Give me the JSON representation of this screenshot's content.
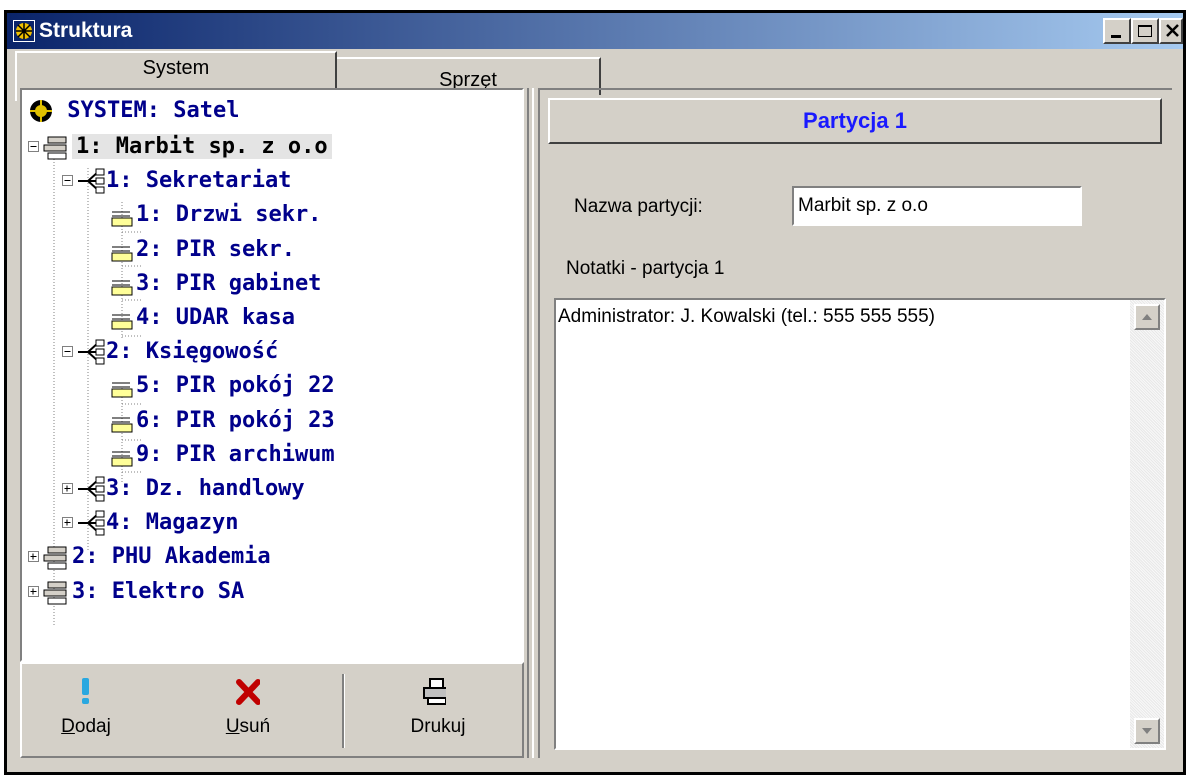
{
  "window": {
    "title": "Struktura"
  },
  "tabs": [
    {
      "label": "System"
    },
    {
      "label": "Sprzęt"
    }
  ],
  "tree": {
    "root": "SYSTEM: Satel",
    "items": [
      {
        "label": "1: Marbit sp. z o.o",
        "type": "partition",
        "expanded": true,
        "selected": true
      },
      {
        "label": "1: Sekretariat",
        "type": "zone",
        "expanded": true
      },
      {
        "label": "1: Drzwi sekr.",
        "type": "input"
      },
      {
        "label": "2: PIR sekr.",
        "type": "input"
      },
      {
        "label": "3: PIR gabinet",
        "type": "input"
      },
      {
        "label": "4: UDAR kasa",
        "type": "input"
      },
      {
        "label": "2: Księgowość",
        "type": "zone",
        "expanded": true
      },
      {
        "label": "5: PIR pokój 22",
        "type": "input"
      },
      {
        "label": "6: PIR pokój 23",
        "type": "input"
      },
      {
        "label": "9: PIR archiwum",
        "type": "input"
      },
      {
        "label": "3: Dz. handlowy",
        "type": "zone",
        "expanded": false
      },
      {
        "label": "4: Magazyn",
        "type": "zone",
        "expanded": false
      },
      {
        "label": "2: PHU Akademia",
        "type": "partition",
        "expanded": false
      },
      {
        "label": "3: Elektro SA",
        "type": "partition",
        "expanded": false
      }
    ]
  },
  "toolbar": {
    "add": {
      "accel": "D",
      "rest": "odaj"
    },
    "remove": {
      "accel": "U",
      "rest": "suń"
    },
    "print": {
      "label": "Drukuj"
    }
  },
  "detail": {
    "header": "Partycja 1",
    "name_label": "Nazwa partycji:",
    "name_value": "Marbit sp. z o.o",
    "notes_label": "Notatki - partycja 1",
    "notes_text": "Administrator: J. Kowalski (tel.: 555 555 555)"
  },
  "colors": {
    "titlebar_start": "#0a246a",
    "titlebar_end": "#a6caf0",
    "tree_text": "#00008b",
    "header_text": "#1a1aff"
  }
}
